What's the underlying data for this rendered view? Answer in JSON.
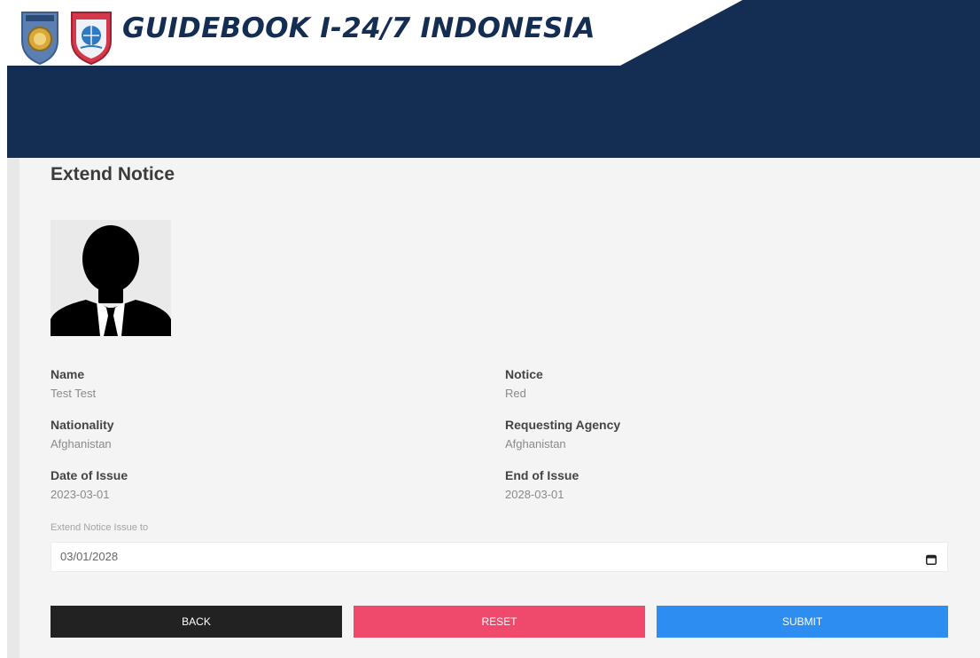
{
  "header": {
    "title": "GUIDEBOOK I-24/7 INDONESIA",
    "logos": [
      "police-shield-logo",
      "interpol-shield-logo"
    ],
    "colors": {
      "banner": "#142d52",
      "title": "#142d52"
    }
  },
  "form": {
    "heading": "Extend Notice",
    "avatar_icon": "person-silhouette-icon",
    "fields": {
      "name": {
        "label": "Name",
        "value": "Test Test"
      },
      "notice": {
        "label": "Notice",
        "value": "Red"
      },
      "nationality": {
        "label": "Nationality",
        "value": "Afghanistan"
      },
      "requesting_agency": {
        "label": "Requesting Agency",
        "value": "Afghanistan"
      },
      "date_of_issue": {
        "label": "Date of Issue",
        "value": "2023-03-01"
      },
      "end_of_issue": {
        "label": "End of Issue",
        "value": "2028-03-01"
      }
    },
    "extend": {
      "label": "Extend Notice Issue to",
      "value": "03/01/2028",
      "icon": "calendar-icon"
    },
    "buttons": {
      "back": "BACK",
      "reset": "RESET",
      "submit": "SUBMIT"
    },
    "colors": {
      "back": "#222222",
      "reset": "#ef4a6c",
      "submit": "#2d8df0",
      "panel": "#f4f4f4"
    }
  }
}
